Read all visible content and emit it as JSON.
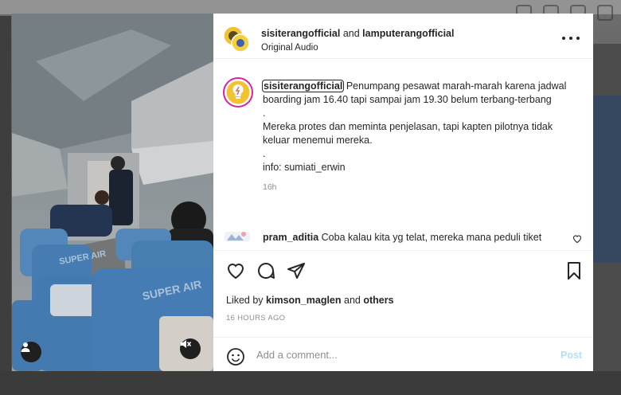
{
  "header": {
    "account1": "sisiterangofficial",
    "connector": "and",
    "account2": "lamputerangofficial",
    "audio": "Original Audio",
    "more_icon": "more-horizontal-icon"
  },
  "caption": {
    "username": "sisiterangofficial",
    "paragraphs": [
      "Penumpang pesawat marah-marah karena jadwal boarding jam 16.40 tapi sampai jam 19.30 belum terbang-terbang",
      ".",
      "Mereka protes dan meminta penjelasan, tapi kapten pilotnya tidak keluar menemui mereka.",
      ".",
      "info: sumiati_erwin"
    ],
    "time": "16h"
  },
  "comment": {
    "username": "pram_aditia",
    "text": "Coba kalau kita yg telat, mereka mana peduli tiket"
  },
  "actions": {
    "liked_by_prefix": "Liked by",
    "liked_by_user": "kimson_maglen",
    "and_text": "and",
    "others": "others",
    "posted_ago": "16 HOURS AGO"
  },
  "add_comment": {
    "placeholder": "Add a comment...",
    "post_label": "Post"
  },
  "colors": {
    "post_disabled": "#b2dffc",
    "secondary_text": "#8e8e8e",
    "primary_text": "#262626",
    "seat_blue": "#5b93c9"
  }
}
